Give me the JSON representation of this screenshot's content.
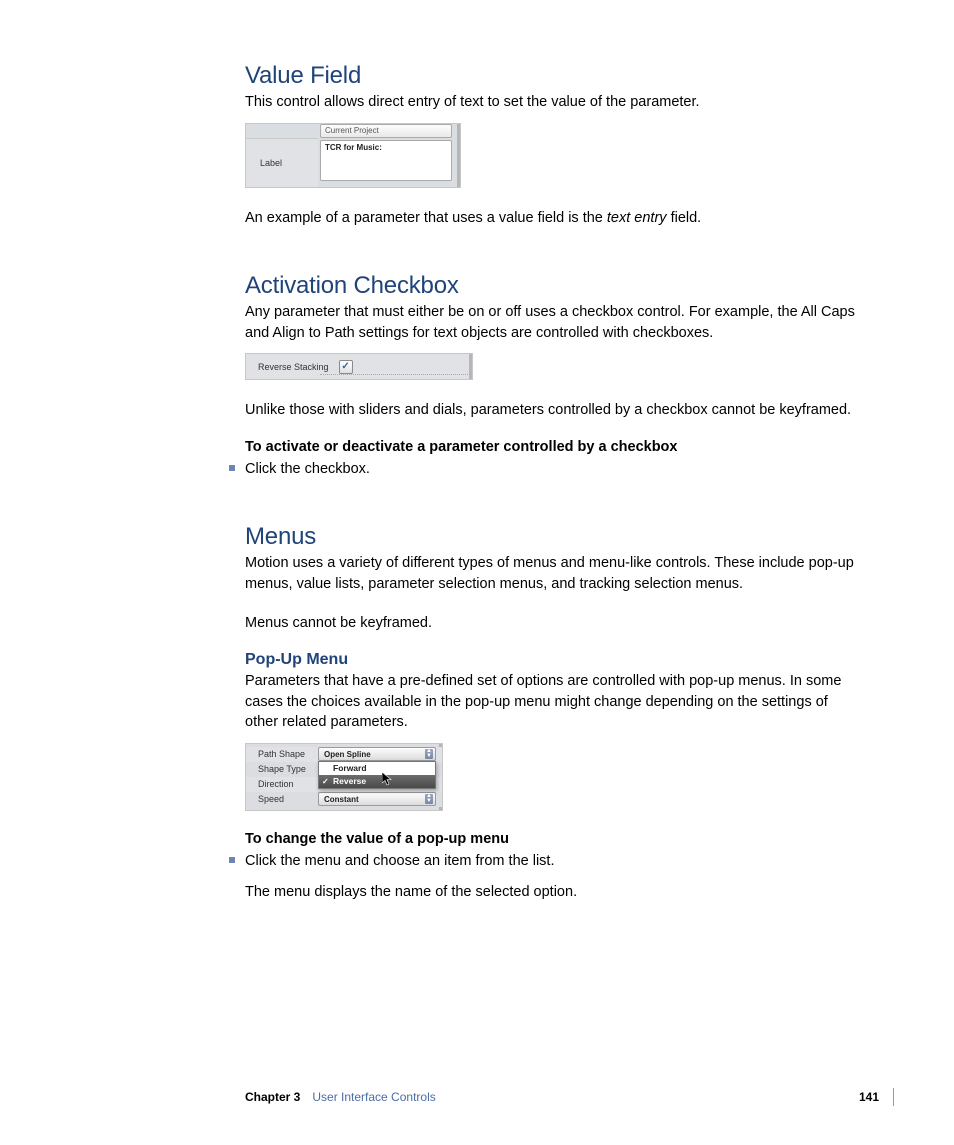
{
  "section1": {
    "heading": "Value Field",
    "p1": "This control allows direct entry of text to set the value of the parameter.",
    "fig": {
      "label": "Label",
      "top_field": "Current Project",
      "textarea_label": "TCR for Music:"
    },
    "p2a": "An example of a parameter that uses a value field is the ",
    "p2_italic": "text entry",
    "p2b": " field."
  },
  "section2": {
    "heading": "Activation Checkbox",
    "p1": "Any parameter that must either be on or off uses a checkbox control. For example, the All Caps and Align to Path settings for text objects are controlled with checkboxes.",
    "fig": {
      "label": "Reverse Stacking",
      "check": "✓"
    },
    "p2": "Unlike those with sliders and dials, parameters controlled by a checkbox cannot be keyframed.",
    "bold": "To activate or deactivate a parameter controlled by a checkbox",
    "bullet1": "Click the checkbox."
  },
  "section3": {
    "heading": "Menus",
    "p1": "Motion uses a variety of different types of menus and menu-like controls. These include pop-up menus, value lists, parameter selection menus, and tracking selection menus.",
    "p2": "Menus cannot be keyframed.",
    "sub_heading": "Pop-Up Menu",
    "p3": "Parameters that have a pre-defined set of options are controlled with pop-up menus. In some cases the choices available in the pop-up menu might change depending on the settings of other related parameters.",
    "fig": {
      "rows": {
        "path_shape_label": "Path Shape",
        "path_shape_value": "Open Spline",
        "shape_type_label": "Shape Type",
        "direction_label": "Direction",
        "speed_label": "Speed",
        "speed_value": "Constant"
      },
      "menu_item1": "Forward",
      "menu_item2": "Reverse"
    },
    "bold": "To change the value of a pop-up menu",
    "bullet1": "Click the menu and choose an item from the list.",
    "p4": "The menu displays the name of the selected option."
  },
  "footer": {
    "chapter": "Chapter 3",
    "title": "User Interface Controls",
    "page": "141"
  }
}
